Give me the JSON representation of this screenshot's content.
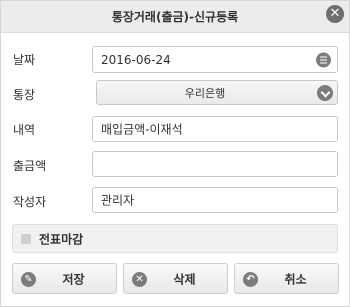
{
  "dialog": {
    "title": "통장거래(출금)-신규등록",
    "close_glyph": "✕"
  },
  "form": {
    "date": {
      "label": "날짜",
      "value": "2016-06-24",
      "icon": "calendar-icon"
    },
    "account": {
      "label": "통장",
      "value": "우리은행",
      "icon": "chevron-down-icon"
    },
    "description": {
      "label": "내역",
      "value": "매입금액-이재석"
    },
    "amount": {
      "label": "출금액",
      "value": ""
    },
    "author": {
      "label": "작성자",
      "value": "관리자"
    },
    "slip_close": {
      "label": "전표마감",
      "checked": false
    }
  },
  "buttons": {
    "save": {
      "label": "저장",
      "icon": "pencil-icon",
      "glyph": "✎"
    },
    "delete": {
      "label": "삭제",
      "icon": "x-circle-icon",
      "glyph": "✕"
    },
    "cancel": {
      "label": "취소",
      "icon": "back-arrow-icon",
      "glyph": "↶"
    }
  },
  "colors": {
    "titlebar": "#ececec",
    "icon_gray": "#7c7c7c",
    "border": "#c8c8c8"
  }
}
